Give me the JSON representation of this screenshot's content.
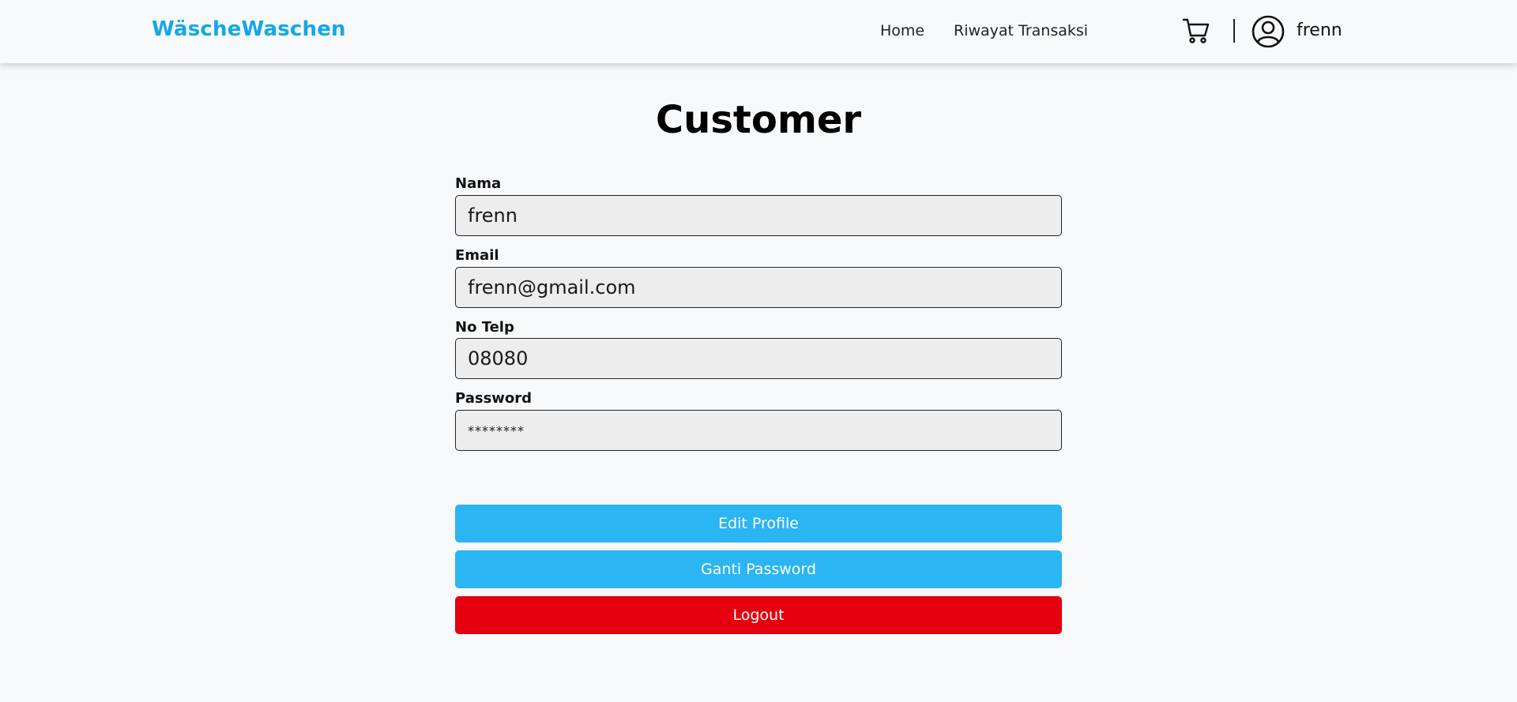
{
  "navbar": {
    "brand": "WäscheWaschen",
    "links": [
      {
        "label": "Home"
      },
      {
        "label": "Riwayat Transaksi"
      }
    ],
    "cart_icon": "cart-icon",
    "avatar_icon": "user-circle-icon",
    "username": "frenn"
  },
  "page": {
    "title": "Customer"
  },
  "form": {
    "nama": {
      "label": "Nama",
      "value": "frenn"
    },
    "email": {
      "label": "Email",
      "value": "frenn@gmail.com"
    },
    "telp": {
      "label": "No Telp",
      "value": "08080"
    },
    "password": {
      "label": "Password",
      "value": "********"
    }
  },
  "buttons": {
    "edit_profile": "Edit Profile",
    "ganti_password": "Ganti Password",
    "logout": "Logout"
  },
  "colors": {
    "brand": "#12a8e8",
    "primary_button": "#2bb5f3",
    "danger_button": "#e6000f",
    "background": "#f8f9fb",
    "input_background": "#ededed"
  }
}
